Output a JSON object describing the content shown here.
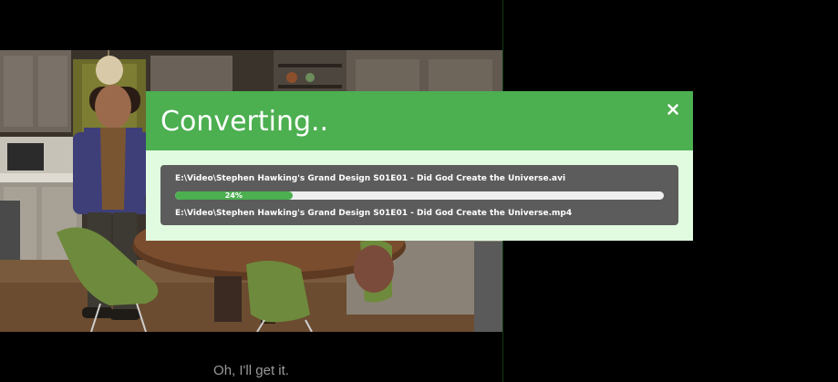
{
  "dialog": {
    "title": "Converting..",
    "close_icon": "close-icon",
    "job": {
      "source_path": "E:\\Video\\Stephen Hawking's Grand Design S01E01 - Did God Create the Universe.avi",
      "destination_path": "E:\\Video\\Stephen Hawking's Grand Design S01E01 - Did God Create the Universe.mp4",
      "progress_label": "24%",
      "progress_fraction": 0.24
    }
  },
  "player": {
    "subtitle": "Oh, I'll get it."
  },
  "colors": {
    "accent_green": "#4caf50",
    "dialog_background": "#e0fbe0",
    "job_panel": "#5c5c5c",
    "progress_track": "#efefef",
    "subtitle_text": "#9a9a9a"
  }
}
